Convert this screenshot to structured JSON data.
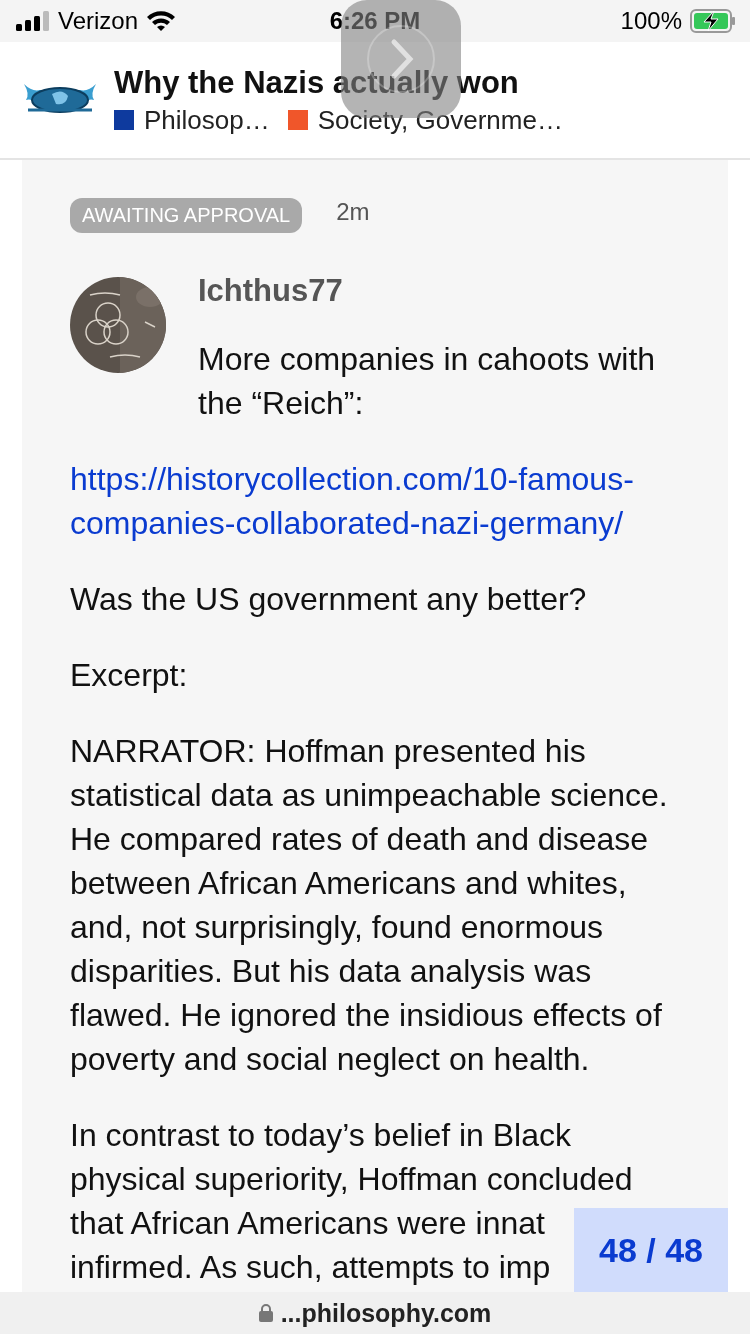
{
  "status_bar": {
    "carrier": "Verizon",
    "time": "6:26 PM",
    "battery": "100%"
  },
  "topic": {
    "title": "Why the Nazis actually won",
    "categories": [
      {
        "name": "Philosop…",
        "color": "#0e3a9e"
      },
      {
        "name": "Society, Governme…",
        "color": "#f0562a"
      }
    ]
  },
  "post": {
    "badge": "AWAITING APPROVAL",
    "age": "2m",
    "author": "Ichthus77",
    "intro": "More companies in cahoots with the “Reich”:",
    "paragraphs": [
      {
        "kind": "link",
        "text": "https://historycollection.com/10-famous-companies-collaborated-nazi-germany/"
      },
      {
        "kind": "text",
        "text": "Was the US government any better?"
      },
      {
        "kind": "text",
        "text": "Excerpt:"
      },
      {
        "kind": "text",
        "text": "NARRATOR: Hoffman presented his statistical data as unimpeachable science. He compared rates of death and disease between African Americans and whites, and, not surprisingly, found enormous disparities. But his data analysis was flawed. He ignored the insidious effects of poverty and social neglect on health."
      }
    ],
    "last_paragraph_lines": [
      "In contrast to today’s belief in Black",
      "physical superiority, Hoffman concluded",
      "that African Americans were innat",
      "infirmed. As such, attempts to imp"
    ]
  },
  "progress": "48 / 48",
  "address": "...philosophy.com"
}
